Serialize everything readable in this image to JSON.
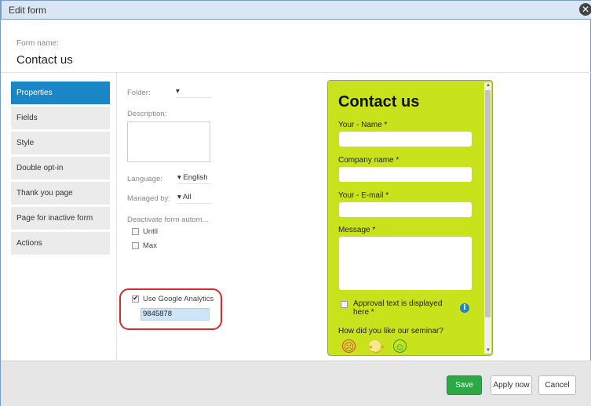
{
  "window": {
    "title": "Edit form"
  },
  "header": {
    "form_name_label": "Form name:",
    "form_name_value": "Contact us"
  },
  "nav": {
    "items": [
      {
        "label": "Properties"
      },
      {
        "label": "Fields"
      },
      {
        "label": "Style"
      },
      {
        "label": "Double opt-in"
      },
      {
        "label": "Thank you page"
      },
      {
        "label": "Page for inactive form"
      },
      {
        "label": "Actions"
      }
    ],
    "active": "Properties"
  },
  "properties": {
    "folder_label": "Folder:",
    "folder_value": "▾",
    "description_label": "Description:",
    "description_value": "",
    "language_label": "Language:",
    "language_value": "▾ English",
    "managed_by_label": "Managed by:",
    "managed_by_value": "▾ All",
    "deactivate_label": "Deactivate form autom...",
    "until_label": "Until",
    "max_label": "Max",
    "google_analytics_label": "Use Google Analytics",
    "google_analytics_checked": true,
    "google_analytics_id": "9845878"
  },
  "preview": {
    "title": "Contact us",
    "name_label": "Your - Name *",
    "company_label": "Company name *",
    "email_label": "Your - E-mail *",
    "message_label": "Message *",
    "approval_label": "Approval text is displayed here *",
    "question_label": "How did you like our seminar?",
    "background_color": "#c8e31c"
  },
  "footer": {
    "save_label": "Save",
    "apply_label": "Apply now",
    "cancel_label": "Cancel"
  },
  "colors": {
    "accent": "#1b86c6",
    "save": "#2aa944",
    "highlight": "#d82832"
  }
}
